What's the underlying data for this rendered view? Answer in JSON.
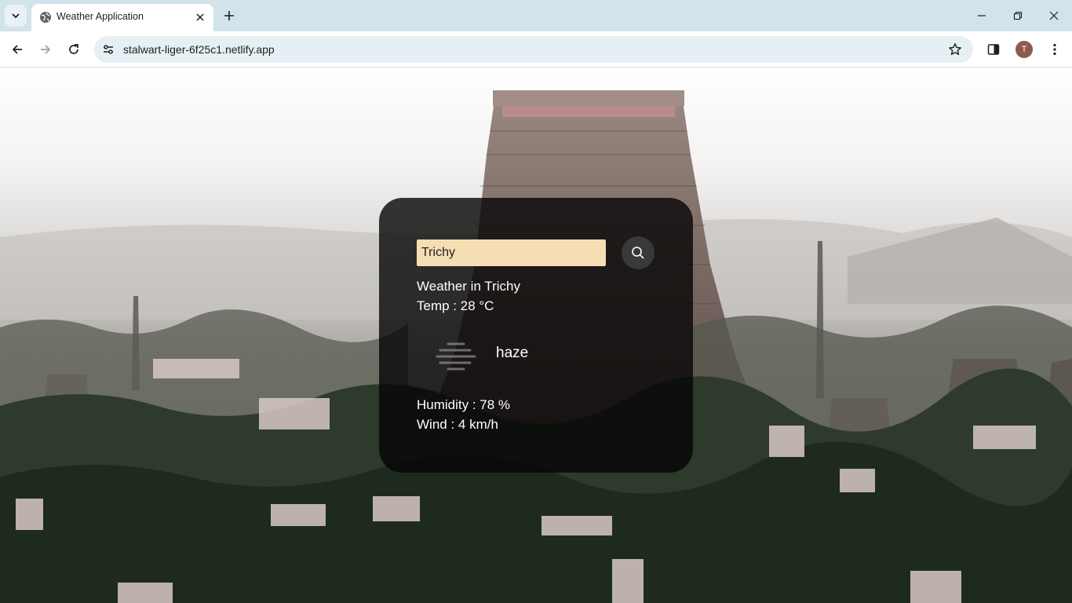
{
  "browser": {
    "tab_title": "Weather Application",
    "url": "stalwart-liger-6f25c1.netlify.app",
    "profile_initial": "T"
  },
  "icons": {
    "tab_search": "chevron-down-icon",
    "favicon": "globe-icon",
    "tab_close": "close-icon",
    "new_tab": "plus-icon",
    "back": "arrow-left-icon",
    "forward": "arrow-right-icon",
    "reload": "reload-icon",
    "site_info": "tune-icon",
    "bookmark": "star-icon",
    "side_panel": "side-panel-icon",
    "menu": "kebab-menu-icon",
    "weather": "haze-icon",
    "search": "search-icon"
  },
  "weather": {
    "search_value": "Trichy",
    "heading": "Weather in Trichy",
    "temp": "Temp : 28 °C",
    "description": "haze",
    "humidity": "Humidity : 78 %",
    "wind": "Wind : 4 km/h"
  },
  "colors": {
    "tabstrip": "#d3e3ec",
    "input_bg": "#f5deb3",
    "card_bg": "rgba(5,5,5,0.80)",
    "search_btn_bg": "#393939"
  }
}
